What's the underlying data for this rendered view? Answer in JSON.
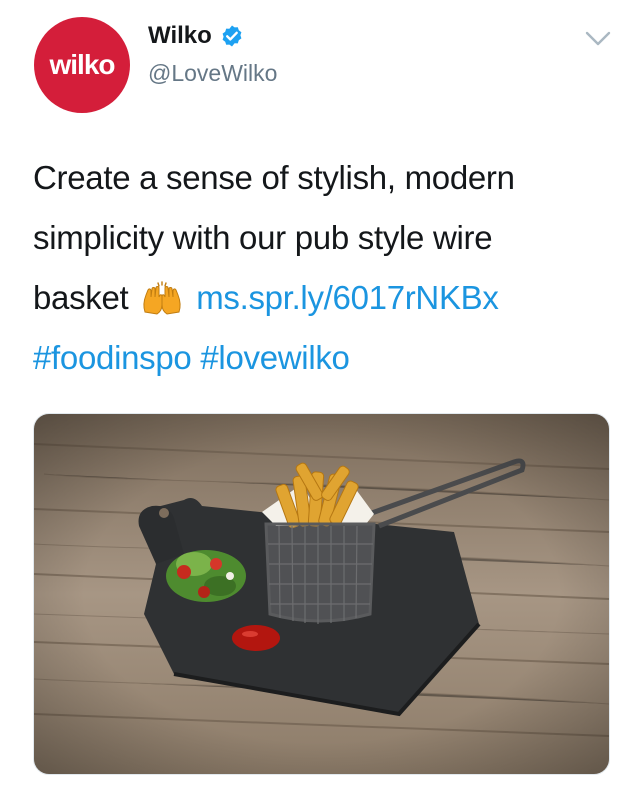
{
  "tweet": {
    "author": {
      "name": "Wilko",
      "handle": "@LoveWilko",
      "avatar_text": "wilko",
      "verified": true
    },
    "text": {
      "line1": "Create a sense of stylish, modern",
      "line2": "simplicity with our pub style wire",
      "line3_prefix": "basket",
      "emoji": "raising-hands-emoji",
      "link": "ms.spr.ly/6017rNKBx",
      "hashtag1": "#foodinspo",
      "hashtag2": "#lovewilko"
    },
    "media": {
      "type": "photo",
      "subject": "chips-in-wire-basket-on-slate-board"
    }
  },
  "colors": {
    "brand_red": "#d41e3a",
    "link_blue": "#1b95e0",
    "verified_blue": "#1da1f2",
    "handle_gray": "#657786",
    "chevron_gray": "#aab8c2"
  },
  "icons": [
    "verified-badge-icon",
    "chevron-down-icon",
    "raising-hands-emoji"
  ]
}
